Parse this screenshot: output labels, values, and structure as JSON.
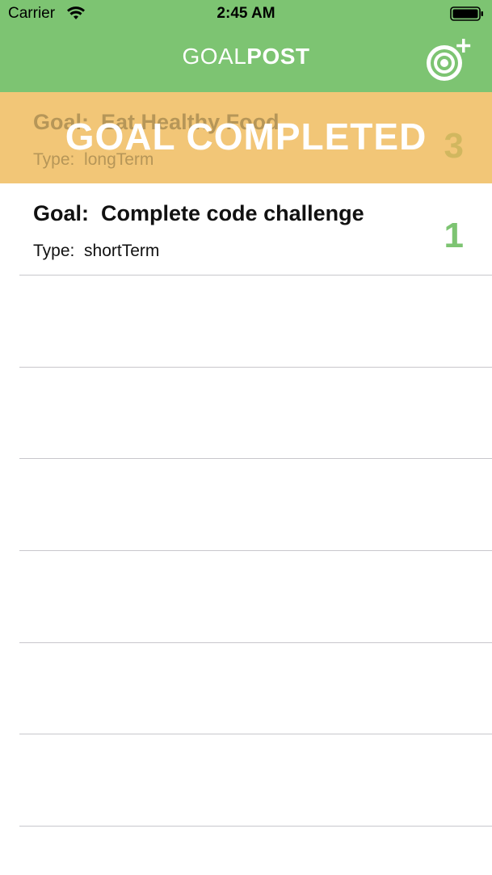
{
  "status_bar": {
    "carrier": "Carrier",
    "time": "2:45 AM"
  },
  "nav": {
    "title_light": "GOAL",
    "title_bold": "POST",
    "add_goal_icon": "target-plus-icon"
  },
  "colors": {
    "brand_green": "#7dc472",
    "completed_orange": "#f2c677",
    "separator": "#c8c7cc"
  },
  "goals": [
    {
      "description_prefix": "Goal:",
      "description": "Eat Healthy Food",
      "type_prefix": "Type:",
      "type": "longTerm",
      "progress": "3",
      "completed": true,
      "completed_label": "GOAL COMPLETED"
    },
    {
      "description_prefix": "Goal:",
      "description": "Complete code challenge",
      "type_prefix": "Type:",
      "type": "shortTerm",
      "progress": "1",
      "completed": false
    }
  ]
}
